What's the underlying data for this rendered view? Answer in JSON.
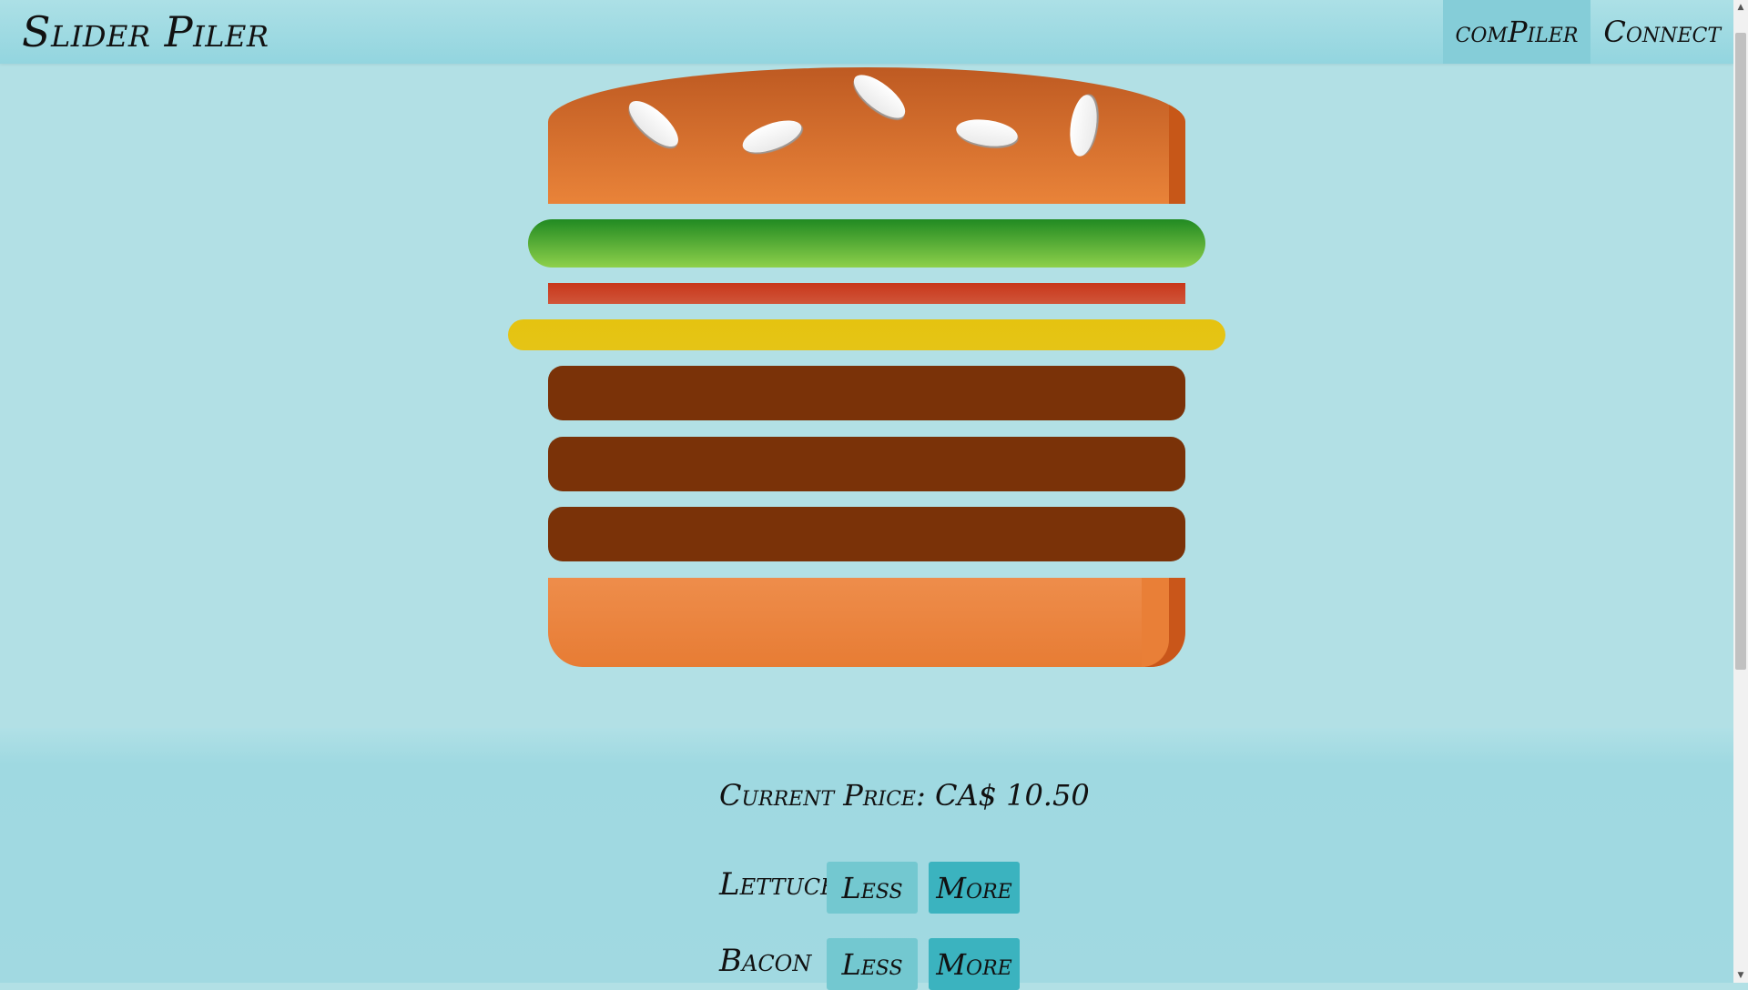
{
  "header": {
    "brand": "Slider Piler",
    "nav": [
      {
        "label": "comPiler",
        "active": true
      },
      {
        "label": "Connect",
        "active": false
      }
    ]
  },
  "burger": {
    "layers": [
      "bun-top",
      "lettuce",
      "bacon",
      "cheese",
      "patty",
      "patty",
      "patty",
      "bun-bottom"
    ],
    "colors": {
      "bun": "#e98339",
      "lettuce": "#3ea32e",
      "bacon": "#c8371a",
      "cheese": "#e5c310",
      "patty": "#7a3208"
    }
  },
  "price": {
    "label": "Current Price:",
    "currency": "CA$",
    "amount": "10.50"
  },
  "ingredients": [
    {
      "name": "Lettuce",
      "less_label": "Less",
      "more_label": "More"
    },
    {
      "name": "Bacon",
      "less_label": "Less",
      "more_label": "More"
    }
  ],
  "colors": {
    "background": "#b2e0e5",
    "header": "#93d5df",
    "button_less": "#73c8d0",
    "button_more": "#3bb3bf"
  }
}
